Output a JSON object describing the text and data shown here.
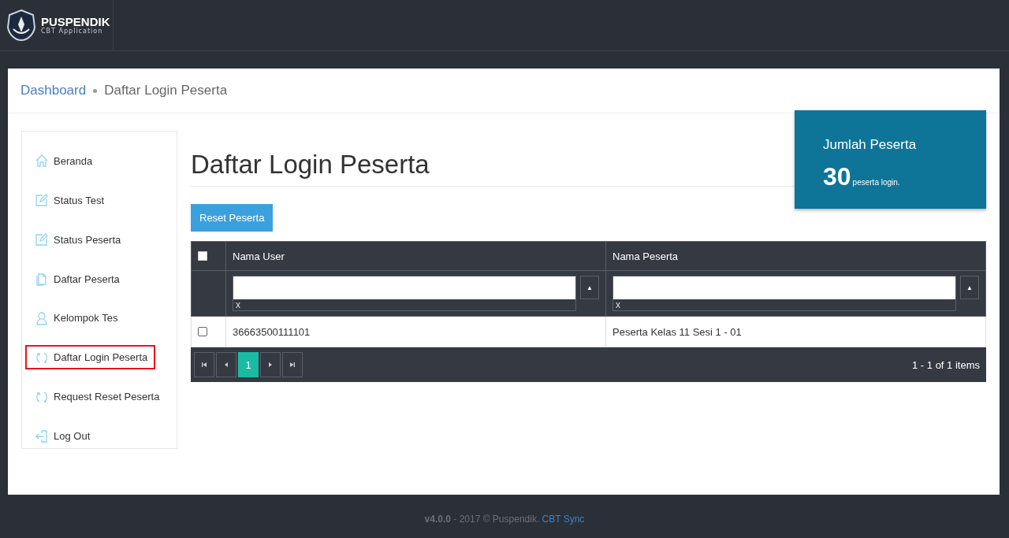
{
  "header": {
    "logo_title": "PUSPENDIK",
    "logo_subtitle": "CBT Application"
  },
  "breadcrumb": [
    {
      "label": "Dashboard",
      "link": true
    },
    {
      "label": "Daftar Login Peserta",
      "link": false
    }
  ],
  "sidebar": {
    "items": [
      {
        "label": "Beranda",
        "kind": "home",
        "selected": false
      },
      {
        "label": "Status Test",
        "kind": "edit",
        "selected": false
      },
      {
        "label": "Status Peserta",
        "kind": "edit",
        "selected": false
      },
      {
        "label": "Daftar Peserta",
        "kind": "files",
        "selected": false
      },
      {
        "label": "Kelompok Tes",
        "kind": "user",
        "selected": false
      },
      {
        "label": "Daftar Login Peserta",
        "kind": "refresh",
        "selected": true
      },
      {
        "label": "Request Reset Peserta",
        "kind": "refresh",
        "selected": false
      },
      {
        "label": "Log Out",
        "kind": "logout",
        "selected": false
      }
    ]
  },
  "page_title": "Daftar Login Peserta",
  "stat_card": {
    "title": "Jumlah Peserta",
    "value": "30",
    "unit": "peserta login."
  },
  "reset_button": "Reset Peserta",
  "table": {
    "select_all_checked": false,
    "columns": [
      {
        "label": "Nama User",
        "sort": "▲",
        "clear": "x"
      },
      {
        "label": "Nama Peserta",
        "sort": "▲",
        "clear": "x"
      }
    ],
    "rows": [
      {
        "checked": false,
        "cells": [
          "36663500111101",
          "Peserta Kelas 11 Sesi 1 - 01"
        ]
      }
    ]
  },
  "pager": {
    "pages": [
      {
        "label": "1",
        "selected": true
      }
    ],
    "summary": "1 - 1 of 1 items"
  },
  "footer": {
    "text": "**v4.0.0** - 2017 © Puspendik.",
    "link": "CBT Sync"
  }
}
